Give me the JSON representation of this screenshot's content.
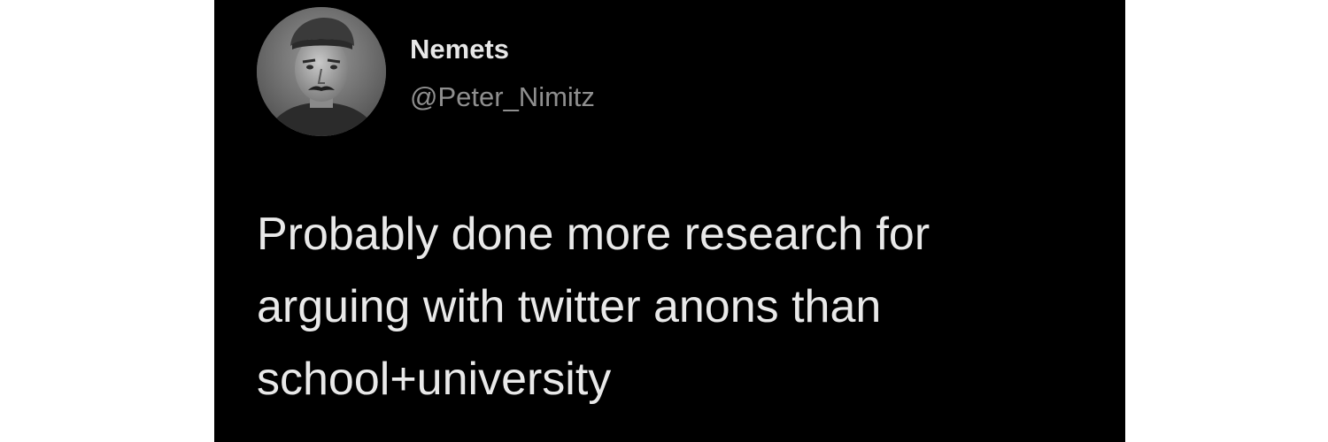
{
  "tweet": {
    "author": {
      "display_name": "Nemets",
      "handle": "@Peter_Nimitz",
      "avatar_icon": "profile-photo"
    },
    "text_lines": [
      "Probably done more research for",
      "arguing with twitter anons than",
      "school+university"
    ]
  },
  "colors": {
    "page_background": "#ffffff",
    "tweet_background": "#000000",
    "primary_text": "#e7e7e7",
    "secondary_text": "#8f8f8f"
  }
}
